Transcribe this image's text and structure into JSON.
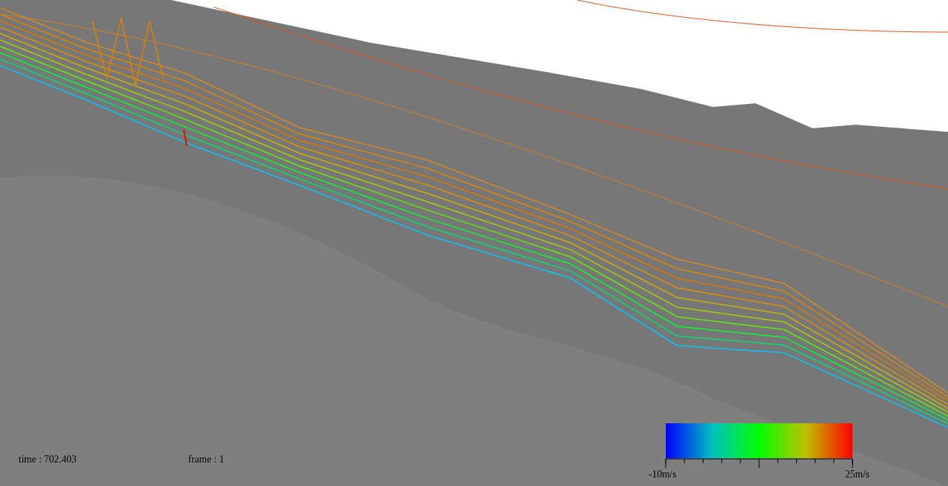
{
  "viewport": {
    "time_label": "time : 702.403",
    "frame_label": "frame : 1"
  },
  "legend": {
    "min_label": "-10m/s",
    "max_label": "25m/s"
  }
}
